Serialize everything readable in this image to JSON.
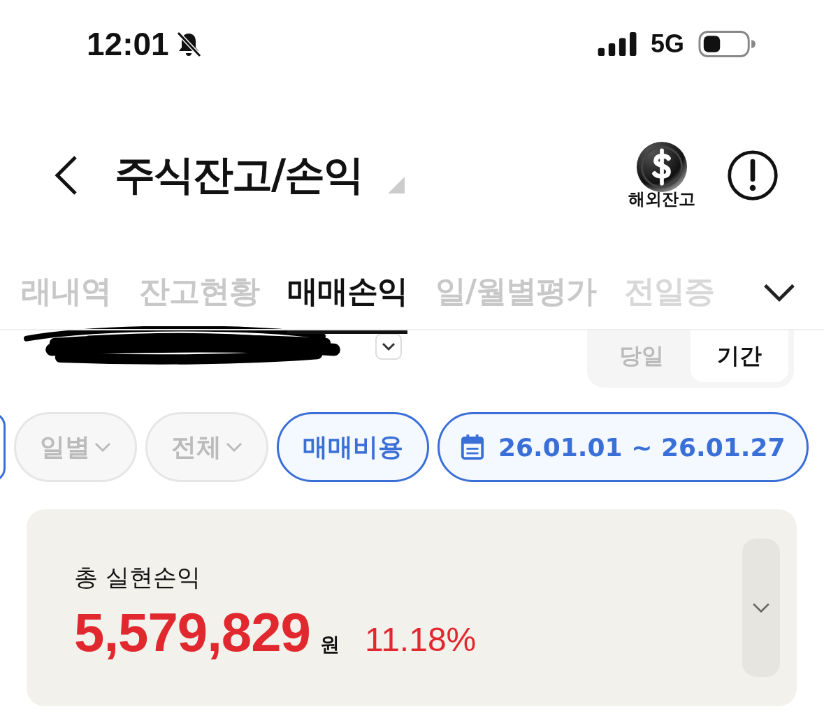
{
  "status_bar": {
    "time": "12:01",
    "muted": true,
    "network": "5G"
  },
  "header": {
    "title": "주식잔고/손익",
    "overseas_label": "해외잔고"
  },
  "tabs": [
    {
      "label": "래내역",
      "selected": false
    },
    {
      "label": "잔고현황",
      "selected": false
    },
    {
      "label": "매매손익",
      "selected": true
    },
    {
      "label": "일/월별평가",
      "selected": false
    },
    {
      "label": "전일증",
      "selected": false
    }
  ],
  "period_toggle": [
    {
      "label": "당일",
      "selected": false
    },
    {
      "label": "기간",
      "selected": true
    }
  ],
  "filters": [
    {
      "kind": "dropdown",
      "label": "일별"
    },
    {
      "kind": "dropdown",
      "label": "전체"
    },
    {
      "kind": "toggle",
      "label": "매매비용"
    },
    {
      "kind": "date",
      "label": "26.01.01 ~ 26.01.27"
    }
  ],
  "summary": {
    "title": "총 실현손익",
    "amount": "5,579,829",
    "unit": "원",
    "rate": "11.18%",
    "expanded": false
  }
}
